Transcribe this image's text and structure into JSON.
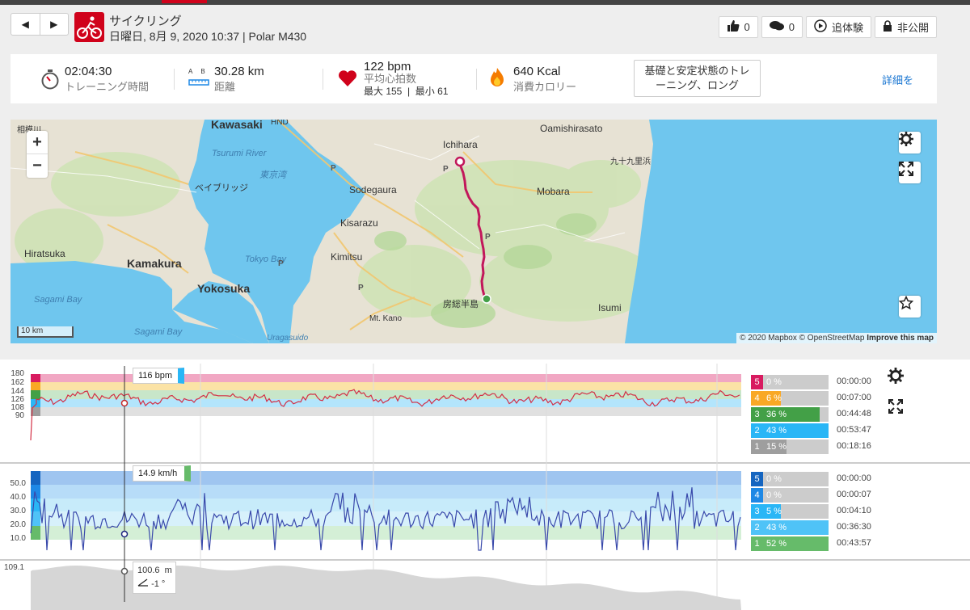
{
  "header": {
    "title": "サイクリング",
    "subtitle": "日曜日, 8月 9, 2020 10:37 | Polar M430",
    "prev_label": "◀",
    "next_label": "▶"
  },
  "actions": {
    "likes": "0",
    "comments": "0",
    "replay_label": "追体験",
    "privacy_label": "非公開"
  },
  "summary": {
    "duration_value": "02:04:30",
    "duration_label": "トレーニング時間",
    "distance_value": "30.28 km",
    "distance_label": "距離",
    "distance_icon_text": "A  B",
    "hr_value": "122 bpm",
    "hr_label": "平均心拍数",
    "hr_sub": "最大 155  |  最小 61",
    "calories_value": "640 Kcal",
    "calories_label": "消費カロリー",
    "training_benefit": "基礎と安定状態のトレーニング、ロング",
    "details_link": "詳細を"
  },
  "map": {
    "labels": {
      "kawasaki": "Kawasaki",
      "hnd": "HND",
      "ichihara": "Ichihara",
      "oamishirasato": "Oamishirasato",
      "kujukuri": "九十九里浜",
      "tsurumi": "Tsurumi River",
      "tokyowan": "東京湾",
      "baybridge": "ベイブリッジ",
      "sodegaura": "Sodegaura",
      "mobara": "Mobara",
      "kisarazu": "Kisarazu",
      "hiratsuka": "Hiratsuka",
      "kamakura": "Kamakura",
      "tokyobay": "Tokyo Bay",
      "kimitsu": "Kimitsu",
      "yokosuka": "Yokosuka",
      "sagamibay1": "Sagami Bay",
      "sagamibay2": "Sagami Bay",
      "mtkano": "Mt. Kano",
      "boso": "房総半島",
      "isumi": "Isumi",
      "uragasuido": "Uragasuido",
      "sagami_small": "相模川",
      "p1": "P",
      "p2": "P",
      "p3": "P",
      "p4": "P",
      "p5": "P"
    },
    "zoom_in": "+",
    "zoom_out": "−",
    "scale": "10 km",
    "attribution_pre": "© 2020 Mapbox © OpenStreetMap",
    "attribution_link": "Improve this map",
    "route_color": "#c2185b",
    "water_color": "#6fc6ee",
    "land_color": "#e8e3d5"
  },
  "hr_chart": {
    "tooltip": "116 bpm",
    "y_ticks": [
      "180",
      "162",
      "144",
      "126",
      "108",
      "90"
    ],
    "zones": [
      {
        "num": "5",
        "pct": "0 %",
        "time": "00:00:00",
        "color": "#d81b60",
        "fill": 0
      },
      {
        "num": "4",
        "pct": "6 %",
        "time": "00:07:00",
        "color": "#f9a825",
        "fill": 0.06
      },
      {
        "num": "3",
        "pct": "36 %",
        "time": "00:44:48",
        "color": "#43a047",
        "fill": 0.36
      },
      {
        "num": "2",
        "pct": "43 %",
        "time": "00:53:47",
        "color": "#29b6f6",
        "fill": 0.43
      },
      {
        "num": "1",
        "pct": "15 %",
        "time": "00:18:16",
        "color": "#9e9e9e",
        "fill": 0.15
      }
    ]
  },
  "speed_chart": {
    "tooltip": "14.9 km/h",
    "y_ticks": [
      "50.0",
      "40.0",
      "30.0",
      "20.0",
      "10.0"
    ],
    "zones": [
      {
        "num": "5",
        "pct": "0 %",
        "time": "00:00:00",
        "color": "#1565c0",
        "fill": 0
      },
      {
        "num": "4",
        "pct": "0 %",
        "time": "00:00:07",
        "color": "#1e88e5",
        "fill": 0
      },
      {
        "num": "3",
        "pct": "5 %",
        "time": "00:04:10",
        "color": "#29b6f6",
        "fill": 0.05
      },
      {
        "num": "2",
        "pct": "43 %",
        "time": "00:36:30",
        "color": "#4fc3f7",
        "fill": 0.43
      },
      {
        "num": "1",
        "pct": "52 %",
        "time": "00:43:57",
        "color": "#66bb6a",
        "fill": 0.52
      }
    ]
  },
  "altitude_chart": {
    "y_max": "109.1",
    "tooltip_alt": "100.6  m",
    "tooltip_incline": "-1 °"
  }
}
